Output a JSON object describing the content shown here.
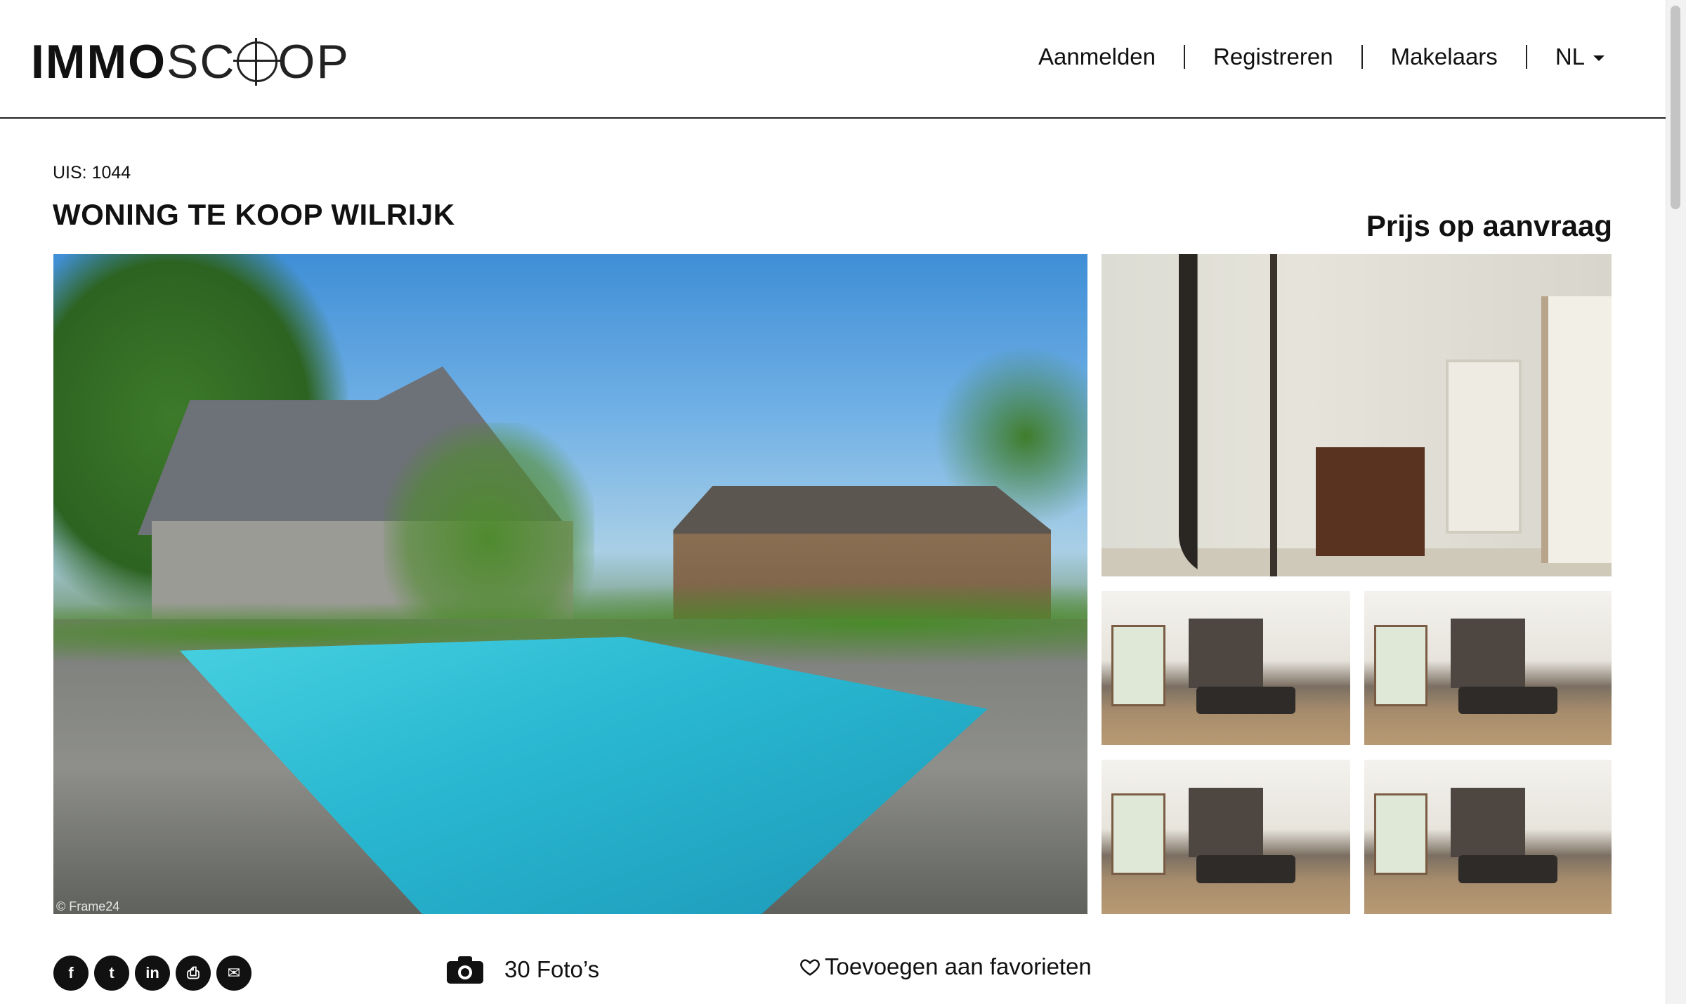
{
  "header": {
    "logo_bold": "IMMO",
    "logo_light_before": "SC",
    "logo_light_after": "OP",
    "nav": {
      "login": "Aanmelden",
      "register": "Registreren",
      "agents": "Makelaars",
      "language": "NL"
    }
  },
  "listing": {
    "uis": "UIS: 1044",
    "title": "WONING TE KOOP WILRIJK",
    "price": "Prijs op aanvraag",
    "photo_credit": "© Frame24"
  },
  "actions": {
    "social": [
      {
        "name": "facebook",
        "glyph": "f"
      },
      {
        "name": "twitter",
        "glyph": "t"
      },
      {
        "name": "linkedin",
        "glyph": "in"
      },
      {
        "name": "print",
        "glyph": "⎙"
      },
      {
        "name": "email",
        "glyph": "✉"
      }
    ],
    "photos_count": "30 Foto’s",
    "favorite": "Toevoegen aan favorieten"
  },
  "icons": {
    "camera": "camera-icon",
    "heart": "heart-icon",
    "caret": "caret-down-icon"
  },
  "colors": {
    "text": "#111111",
    "border": "#222222",
    "background": "#ffffff"
  }
}
